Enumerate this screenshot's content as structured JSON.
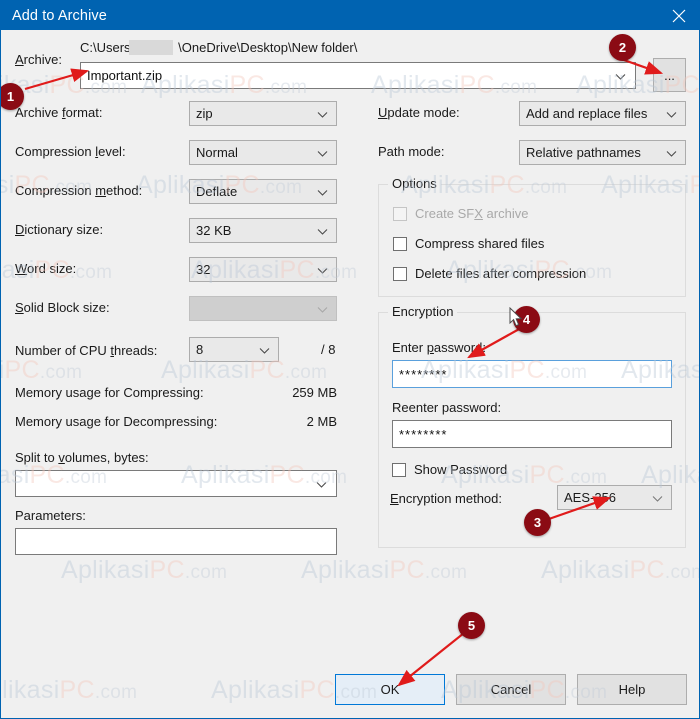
{
  "window": {
    "title": "Add to Archive",
    "close_icon": "close-icon",
    "title_bar_color": "#0063B1",
    "background_color": "#F0F0F0"
  },
  "archive": {
    "label": "Archive:",
    "label_accel": "A",
    "path_prefix": "C:\\Users\\",
    "path_suffix": "\\OneDrive\\Desktop\\New folder\\",
    "name_value": "Important.zip",
    "browse_button_label": "...",
    "dropdown_icon": "chevron-down-icon"
  },
  "left_column": {
    "archive_format": {
      "label": "Archive format:",
      "accel": "f",
      "value": "zip"
    },
    "compression_level": {
      "label": "Compression level:",
      "accel": "l",
      "value": "Normal"
    },
    "compression_method": {
      "label": "Compression method:",
      "accel": "m",
      "value": "Deflate"
    },
    "dictionary_size": {
      "label": "Dictionary size:",
      "accel": "D",
      "value": "32 KB"
    },
    "word_size": {
      "label": "Word size:",
      "accel": "W",
      "value": "32"
    },
    "solid_block_size": {
      "label": "Solid Block size:",
      "accel": "S",
      "value": "",
      "disabled": true
    },
    "cpu_threads": {
      "label": "Number of CPU threads:",
      "accel": "t",
      "value": "8",
      "max_text": "/ 8"
    },
    "memory_compressing": {
      "label": "Memory usage for Compressing:",
      "value": "259 MB"
    },
    "memory_decompressing": {
      "label": "Memory usage for Decompressing:",
      "value": "2 MB"
    },
    "split_volumes": {
      "label": "Split to volumes, bytes:",
      "accel": "v",
      "value": ""
    },
    "parameters": {
      "label": "Parameters:",
      "value": ""
    }
  },
  "right_column": {
    "update_mode": {
      "label": "Update mode:",
      "accel": "U",
      "value": "Add and replace files"
    },
    "path_mode": {
      "label": "Path mode:",
      "value": "Relative pathnames"
    },
    "options": {
      "title": "Options",
      "items": [
        {
          "label": "Create SFX archive",
          "accel": "X",
          "checked": false,
          "disabled": true
        },
        {
          "label": "Compress shared files",
          "checked": false,
          "disabled": false
        },
        {
          "label": "Delete files after compression",
          "checked": false,
          "disabled": false
        }
      ]
    },
    "encryption": {
      "title": "Encryption",
      "enter_password": {
        "label": "Enter password:",
        "accel": "p",
        "value": "********"
      },
      "reenter_password": {
        "label": "Reenter password:",
        "value": "********"
      },
      "show_password": {
        "label": "Show Password",
        "checked": false
      },
      "encryption_method": {
        "label": "Encryption method:",
        "accel": "E",
        "value": "AES-256"
      }
    }
  },
  "buttons": {
    "ok": "OK",
    "cancel": "Cancel",
    "help": "Help"
  },
  "annotations": [
    {
      "number": "1"
    },
    {
      "number": "2"
    },
    {
      "number": "3"
    },
    {
      "number": "4"
    },
    {
      "number": "5"
    }
  ],
  "watermark": {
    "part_a": "Aplikasi",
    "part_b": "PC",
    "part_c": ".com"
  }
}
